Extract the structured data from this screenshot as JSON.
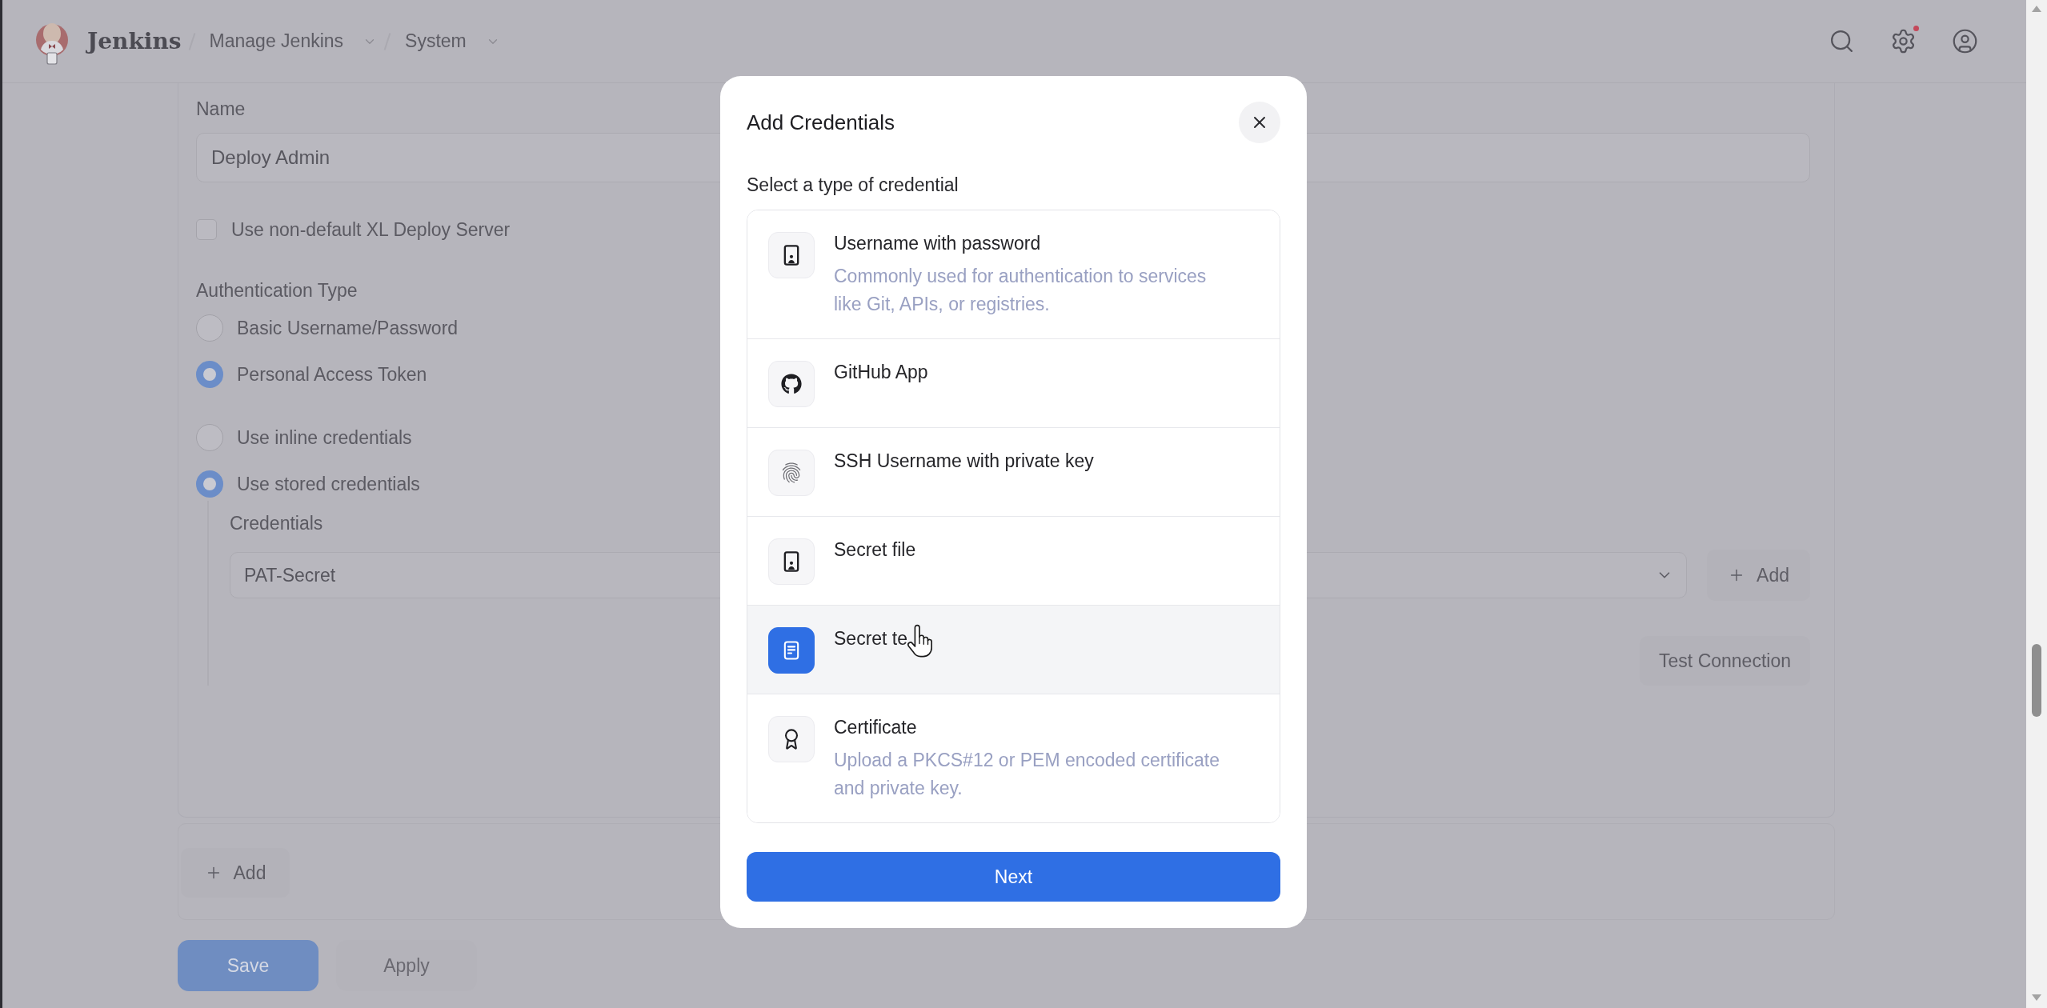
{
  "header": {
    "brand": "Jenkins",
    "breadcrumbs": [
      {
        "label": "Manage Jenkins"
      },
      {
        "label": "System"
      }
    ],
    "settings_alert": true
  },
  "form": {
    "name": {
      "label": "Name",
      "value": "Deploy Admin"
    },
    "server_option": {
      "label": "Use non-default XL Deploy Server",
      "checked": false
    },
    "auth_type": {
      "label": "Authentication Type",
      "options": [
        {
          "label": "Basic Username/Password",
          "selected": false
        },
        {
          "label": "Personal Access Token",
          "selected": true
        }
      ]
    },
    "credential_mode": {
      "options": [
        {
          "label": "Use inline credentials",
          "selected": false
        },
        {
          "label": "Use stored credentials",
          "selected": true
        }
      ]
    },
    "credentials": {
      "label": "Credentials",
      "value": "PAT-Secret",
      "add_button": "Add"
    },
    "test_button": "Test Connection"
  },
  "add_button": "Add",
  "actions": [
    {
      "label": "Save",
      "kind": "primary"
    },
    {
      "label": "Apply",
      "kind": "secondary"
    }
  ],
  "dialog": {
    "title": "Add Credentials",
    "prompt": "Select a type of credential",
    "types": [
      {
        "title": "Username with password",
        "description": "Commonly used for authentication to services like Git, APIs, or registries.",
        "selected": false,
        "hovered": false
      },
      {
        "title": "GitHub App",
        "selected": false,
        "hovered": false
      },
      {
        "title": "SSH Username with private key",
        "selected": false,
        "hovered": false
      },
      {
        "title": "Secret file",
        "selected": false,
        "hovered": false
      },
      {
        "title": "Secret te",
        "selected": true,
        "hovered": true
      },
      {
        "title": "Certificate",
        "description": "Upload a PKCS#12 or PEM encoded certificate and private key.",
        "selected": false,
        "hovered": false
      }
    ],
    "next_button": "Next"
  }
}
